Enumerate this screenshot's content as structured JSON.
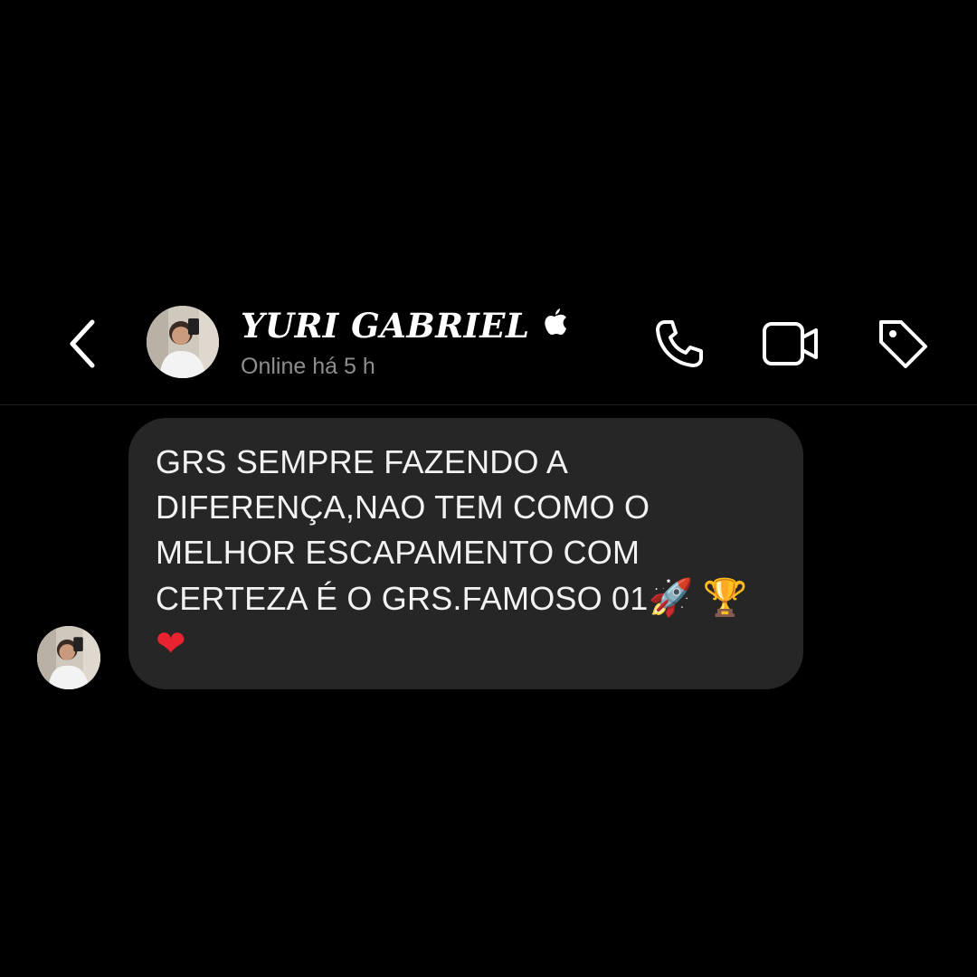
{
  "header": {
    "contact_name": "YURI GABRIEL",
    "status": "Online há 5 h",
    "back_icon": "chevron-left-icon",
    "badge_icon": "apple-icon",
    "actions": [
      {
        "icon": "phone-icon",
        "label": "call"
      },
      {
        "icon": "video-camera-icon",
        "label": "video call"
      },
      {
        "icon": "tag-icon",
        "label": "tag"
      }
    ]
  },
  "message": {
    "lines": [
      "GRS SEMPRE FAZENDO A",
      "DIFERENÇA,NAO TEM COMO O",
      "MELHOR ESCAPAMENTO COM",
      "CERTEZA É O GRS.FAMOSO 01"
    ],
    "emojis_line4": [
      "🚀",
      "🏆"
    ],
    "emojis_line5": [
      "❤"
    ]
  },
  "colors": {
    "background": "#000000",
    "bubble": "#262626",
    "status_text": "#8e8e8e",
    "text": "#ffffff"
  }
}
